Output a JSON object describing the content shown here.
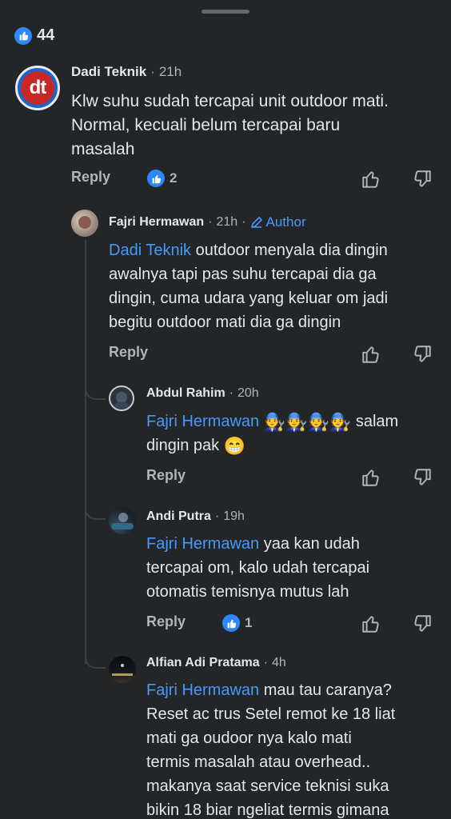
{
  "top": {
    "like_count": "44"
  },
  "comments": [
    {
      "name": "Dadi Teknik",
      "time": "21h",
      "text_lines": [
        "Klw suhu sudah tercapai unit outdoor mati.",
        "Normal, kecuali belum tercapai baru",
        "masalah"
      ],
      "reply_label": "Reply",
      "like_count": "2",
      "avatar_text": "dt"
    },
    {
      "name": "Fajri Hermawan",
      "time": "21h",
      "author_label": "Author",
      "mention": "Dadi Teknik",
      "text_first": "outdoor menyala dia dingin",
      "text_lines": [
        "awalnya tapi pas suhu tercapai dia ga",
        "dingin, cuma udara yang keluar om jadi",
        "begitu outdoor mati dia ga dingin"
      ],
      "reply_label": "Reply"
    },
    {
      "name": "Abdul Rahim",
      "time": "20h",
      "mention": "Fajri Hermawan",
      "emoji": "🧑‍🔧🧑‍🔧🧑‍🔧🧑‍🔧",
      "text_first": "salam",
      "text_lines": [
        "dingin pak"
      ],
      "end_emoji": "😁",
      "reply_label": "Reply"
    },
    {
      "name": "Andi Putra",
      "time": "19h",
      "mention": "Fajri Hermawan",
      "text_first": "yaa kan udah",
      "text_lines": [
        "tercapai om, kalo udah tercapai",
        "otomatis temisnya mutus lah"
      ],
      "reply_label": "Reply",
      "like_count": "1"
    },
    {
      "name": "Alfian Adi Pratama",
      "time": "4h",
      "mention": "Fajri Hermawan",
      "text_first": "mau tau caranya?",
      "text_lines": [
        "Reset ac trus Setel remot ke 18 liat",
        "mati ga oudoor nya kalo mati",
        "termis masalah atau overhead..",
        "makanya saat service teknisi suka",
        "bikin 18  biar ngeliat termis gimana"
      ]
    }
  ],
  "separator": "·",
  "icons": [
    "like-icon",
    "thumbs-up-icon",
    "thumbs-down-icon",
    "pencil-icon"
  ],
  "colors": {
    "background": "#242526",
    "mention": "#4599ff",
    "like_blue": "#2d88ff",
    "secondary_text": "#b0b3b8"
  }
}
